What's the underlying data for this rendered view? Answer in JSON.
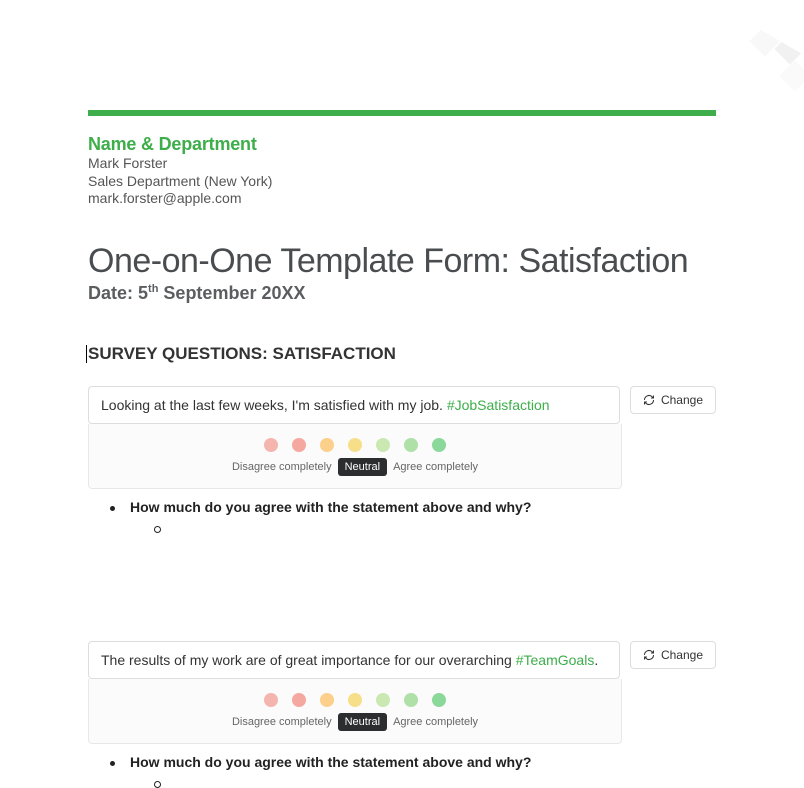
{
  "header": {
    "section_label": "Name & Department",
    "name": "Mark Forster",
    "department": "Sales Department (New York)",
    "email": "mark.forster@apple.com"
  },
  "title": "One-on-One Template Form: Satisfaction",
  "date": {
    "prefix": "Date: 5",
    "ord": "th",
    "rest": " September 20XX"
  },
  "survey_heading": "SURVEY QUESTIONS: SATISFACTION",
  "change_label": "Change",
  "scale": {
    "left": "Disagree completely",
    "mid": "Neutral",
    "right": "Agree completely"
  },
  "q1": {
    "text": "Looking at the last few weeks, I'm satisfied with my job. ",
    "tag": "#JobSatisfaction",
    "followup": "How much do you agree with the statement above and why?"
  },
  "q2": {
    "text": "The results of my work are of great importance for our overarching ",
    "tag": "#TeamGoals",
    "suffix": ".",
    "followup": "How much do you agree with the statement above and why?"
  }
}
